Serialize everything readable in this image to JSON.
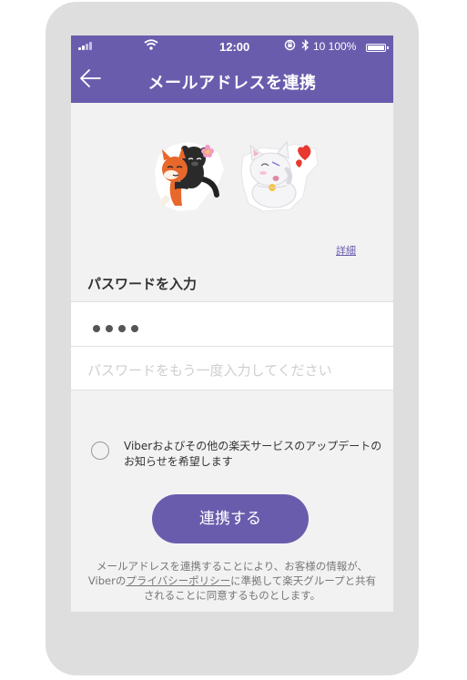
{
  "status_bar": {
    "time": "12:00",
    "battery_text": "10 100%",
    "icons": [
      "signal-icon",
      "wifi-icon",
      "rotation-lock-icon",
      "bluetooth-icon",
      "battery-icon"
    ]
  },
  "header": {
    "title": "メールアドレスを連携",
    "back_icon": "back-arrow-icon"
  },
  "stickers": [
    "fox-and-panther-sticker",
    "white-cat-sticker"
  ],
  "details_link": "詳細",
  "password_section": {
    "label": "パスワードを入力",
    "password_value": "••••",
    "confirm_placeholder": "パスワードをもう一度入力してください"
  },
  "newsletter": {
    "checked": false,
    "label": "Viberおよびその他の楽天サービスのアップデートのお知らせを希望します"
  },
  "cta_label": "連携する",
  "legal": {
    "before": "メールアドレスを連携することにより、お客様の情報が、Viberの",
    "link": "プライバシーポリシー",
    "after": "に準拠して楽天グループと共有されることに同意するものとします。"
  },
  "colors": {
    "brand": "#6a5cad",
    "screen_bg": "#f2f2f2",
    "frame": "#dedede"
  }
}
